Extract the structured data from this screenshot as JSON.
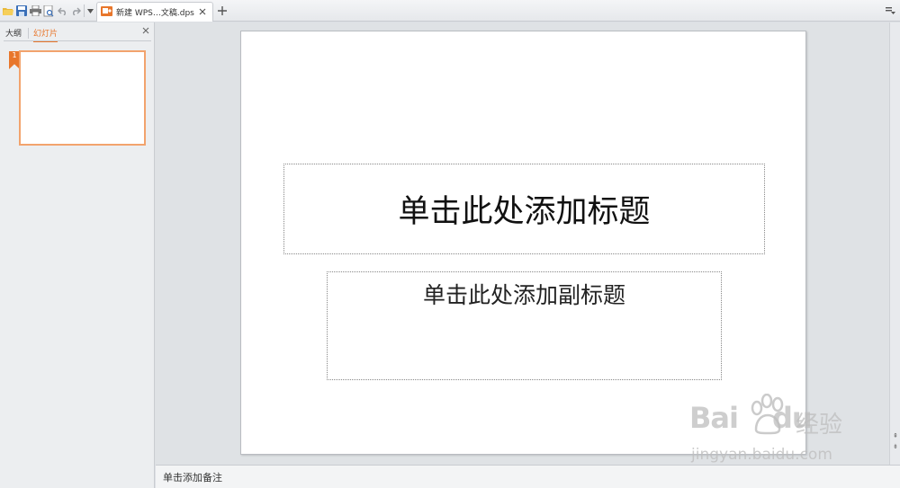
{
  "toolbar": {
    "tab_title": "新建 WPS…文稿.dps"
  },
  "left_pane": {
    "tabs": [
      {
        "label": "大纲"
      },
      {
        "label": "幻灯片"
      }
    ],
    "active_tab": "幻灯片",
    "slides": [
      {
        "number": "1"
      }
    ]
  },
  "slide": {
    "title_placeholder": "单击此处添加标题",
    "subtitle_placeholder": "单击此处添加副标题"
  },
  "notes": {
    "placeholder": "单击添加备注"
  },
  "watermark": {
    "logo_text": "Bai",
    "logo_text_2": "du",
    "logo_cn": "经验",
    "url": "jingyan.baidu.com"
  },
  "colors": {
    "accent": "#e8762b",
    "thumb_border": "#f2a36d"
  }
}
